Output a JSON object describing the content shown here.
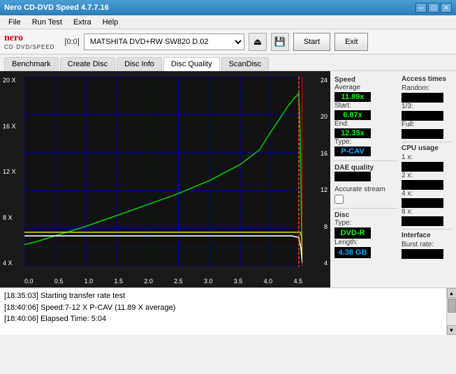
{
  "titleBar": {
    "title": "Nero CD-DVD Speed 4.7.7.16",
    "minimizeBtn": "─",
    "maximizeBtn": "□",
    "closeBtn": "✕"
  },
  "menuBar": {
    "items": [
      "File",
      "Run Test",
      "Extra",
      "Help"
    ]
  },
  "toolbar": {
    "driveLabel": "[0:0]",
    "driveName": "MATSHITA DVD+RW SW820 D.02",
    "startLabel": "Start",
    "exitLabel": "Exit"
  },
  "tabs": [
    {
      "label": "Benchmark",
      "active": false
    },
    {
      "label": "Create Disc",
      "active": false
    },
    {
      "label": "Disc Info",
      "active": false
    },
    {
      "label": "Disc Quality",
      "active": true
    },
    {
      "label": "ScanDisc",
      "active": false
    }
  ],
  "chart": {
    "yAxisLeft": [
      "20 X",
      "16 X",
      "12 X",
      "8 X",
      "4 X"
    ],
    "yAxisRight": [
      "24",
      "20",
      "16",
      "12",
      "8",
      "4"
    ],
    "xAxisLabels": [
      "0.0",
      "0.5",
      "1.0",
      "1.5",
      "2.0",
      "2.5",
      "3.0",
      "3.5",
      "4.0",
      "4.5"
    ]
  },
  "stats": {
    "speed": {
      "header": "Speed",
      "average": {
        "label": "Average",
        "value": "11.89x"
      },
      "start": {
        "label": "Start:",
        "value": "6.87x"
      },
      "end": {
        "label": "End:",
        "value": "12.35x"
      },
      "type": {
        "label": "Type:",
        "value": "P-CAV"
      }
    },
    "daeQuality": {
      "header": "DAE quality",
      "value": ""
    },
    "accurateStream": {
      "label": "Accurate stream",
      "checked": false
    },
    "disc": {
      "header": "Disc",
      "type": {
        "label": "Type:",
        "value": "DVD-R"
      },
      "length": {
        "label": "Length:",
        "value": "4.38 GB"
      }
    },
    "accessTimes": {
      "header": "Access times",
      "random": {
        "label": "Random:",
        "value": ""
      },
      "oneThird": {
        "label": "1/3:",
        "value": ""
      },
      "full": {
        "label": "Full:",
        "value": ""
      },
      "cpuUsage": {
        "header": "CPU usage",
        "1x": {
          "label": "1 x:",
          "value": ""
        },
        "2x": {
          "label": "2 x:",
          "value": ""
        },
        "4x": {
          "label": "4 x:",
          "value": ""
        },
        "8x": {
          "label": "8 x:",
          "value": ""
        }
      },
      "interface": {
        "header": "Interface",
        "burstRate": {
          "label": "Burst rate:",
          "value": ""
        }
      }
    }
  },
  "log": {
    "lines": [
      "[18:35:03]  Starting transfer rate test",
      "[18:40:06]  Speed:7-12 X P-CAV (11.89 X average)",
      "[18:40:06]  Elapsed Time: 5:04"
    ]
  }
}
